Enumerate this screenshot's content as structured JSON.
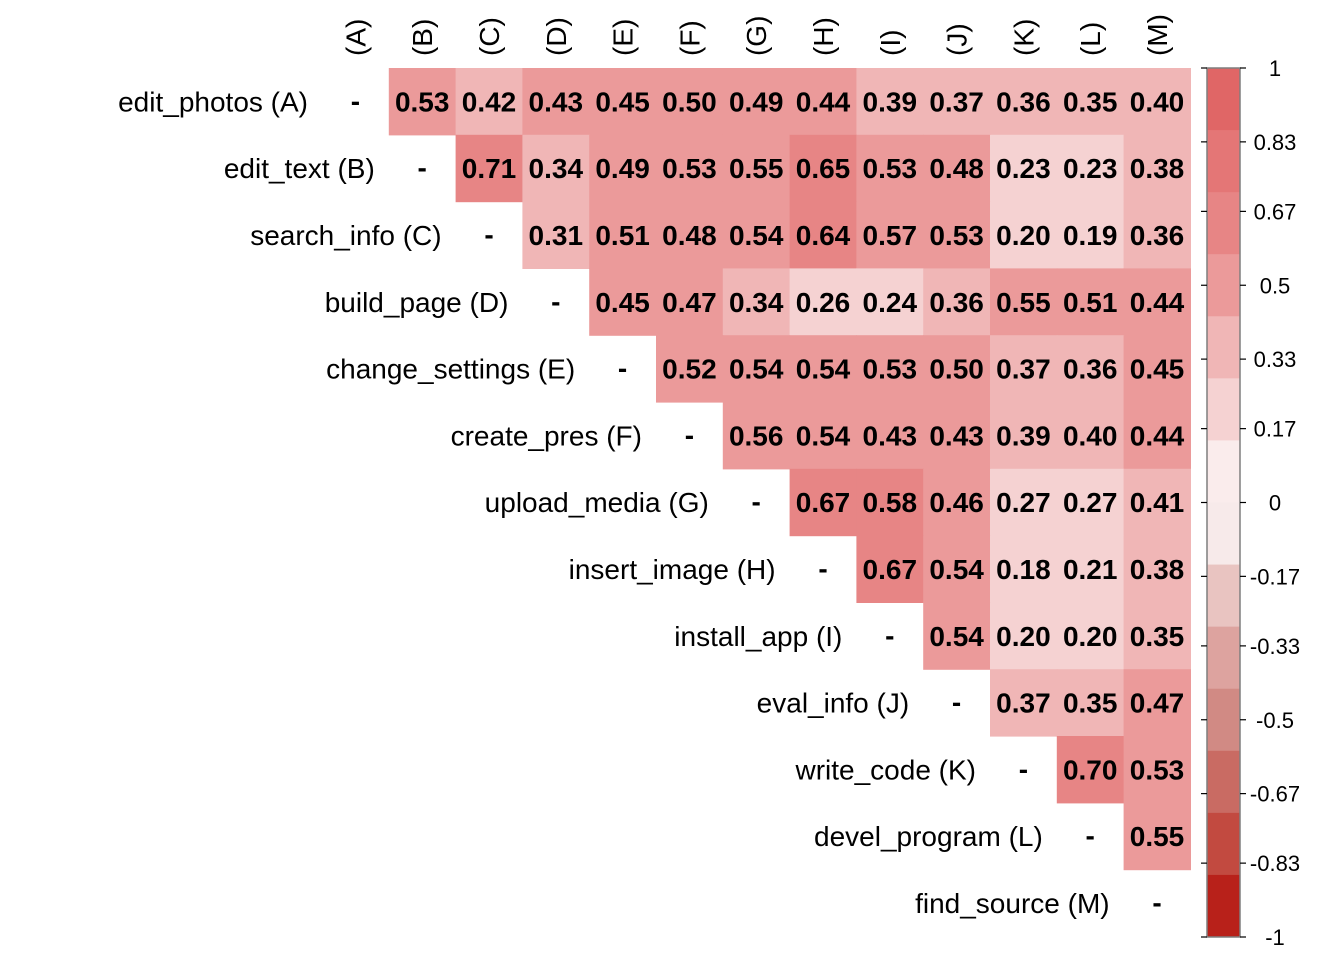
{
  "chart_data": {
    "type": "heatmap",
    "subtype": "correlation-matrix-upper-triangle",
    "row_labels": [
      "edit_photos (A)",
      "edit_text (B)",
      "search_info (C)",
      "build_page (D)",
      "change_settings (E)",
      "create_pres (F)",
      "upload_media (G)",
      "insert_image (H)",
      "install_app (I)",
      "eval_info (J)",
      "write_code (K)",
      "devel_program (L)",
      "find_source (M)"
    ],
    "column_labels": [
      "(A)",
      "(B)",
      "(C)",
      "(D)",
      "(E)",
      "(F)",
      "(G)",
      "(H)",
      "(I)",
      "(J)",
      "(K)",
      "(L)",
      "(M)"
    ],
    "diagonal_label": "-",
    "values": [
      [
        null,
        0.53,
        0.42,
        0.43,
        0.45,
        0.5,
        0.49,
        0.44,
        0.39,
        0.37,
        0.36,
        0.35,
        0.4
      ],
      [
        null,
        null,
        0.71,
        0.34,
        0.49,
        0.53,
        0.55,
        0.65,
        0.53,
        0.48,
        0.23,
        0.23,
        0.38
      ],
      [
        null,
        null,
        null,
        0.31,
        0.51,
        0.48,
        0.54,
        0.64,
        0.57,
        0.53,
        0.2,
        0.19,
        0.36
      ],
      [
        null,
        null,
        null,
        null,
        0.45,
        0.47,
        0.34,
        0.26,
        0.24,
        0.36,
        0.55,
        0.51,
        0.44
      ],
      [
        null,
        null,
        null,
        null,
        null,
        0.52,
        0.54,
        0.54,
        0.53,
        0.5,
        0.37,
        0.36,
        0.45
      ],
      [
        null,
        null,
        null,
        null,
        null,
        null,
        0.56,
        0.54,
        0.43,
        0.43,
        0.39,
        0.4,
        0.44
      ],
      [
        null,
        null,
        null,
        null,
        null,
        null,
        null,
        0.67,
        0.58,
        0.46,
        0.27,
        0.27,
        0.41
      ],
      [
        null,
        null,
        null,
        null,
        null,
        null,
        null,
        null,
        0.67,
        0.54,
        0.18,
        0.21,
        0.38
      ],
      [
        null,
        null,
        null,
        null,
        null,
        null,
        null,
        null,
        null,
        0.54,
        0.2,
        0.2,
        0.35
      ],
      [
        null,
        null,
        null,
        null,
        null,
        null,
        null,
        null,
        null,
        null,
        0.37,
        0.35,
        0.47
      ],
      [
        null,
        null,
        null,
        null,
        null,
        null,
        null,
        null,
        null,
        null,
        null,
        0.7,
        0.53
      ],
      [
        null,
        null,
        null,
        null,
        null,
        null,
        null,
        null,
        null,
        null,
        null,
        null,
        0.55
      ],
      [
        null,
        null,
        null,
        null,
        null,
        null,
        null,
        null,
        null,
        null,
        null,
        null,
        null
      ]
    ],
    "value_labels": [
      [
        null,
        "0.53",
        "0.42",
        "0.43",
        "0.45",
        "0.50",
        "0.49",
        "0.44",
        "0.39",
        "0.37",
        "0.36",
        "0.35",
        "0.40"
      ],
      [
        null,
        null,
        "0.71",
        "0.34",
        "0.49",
        "0.53",
        "0.55",
        "0.65",
        "0.53",
        "0.48",
        "0.23",
        "0.23",
        "0.38"
      ],
      [
        null,
        null,
        null,
        "0.31",
        "0.51",
        "0.48",
        "0.54",
        "0.64",
        "0.57",
        "0.53",
        "0.20",
        "0.19",
        "0.36"
      ],
      [
        null,
        null,
        null,
        null,
        "0.45",
        "0.47",
        "0.34",
        "0.26",
        "0.24",
        "0.36",
        "0.55",
        "0.51",
        "0.44"
      ],
      [
        null,
        null,
        null,
        null,
        null,
        "0.52",
        "0.54",
        "0.54",
        "0.53",
        "0.50",
        "0.37",
        "0.36",
        "0.45"
      ],
      [
        null,
        null,
        null,
        null,
        null,
        null,
        "0.56",
        "0.54",
        "0.43",
        "0.43",
        "0.39",
        "0.40",
        "0.44"
      ],
      [
        null,
        null,
        null,
        null,
        null,
        null,
        null,
        "0.67",
        "0.58",
        "0.46",
        "0.27",
        "0.27",
        "0.41"
      ],
      [
        null,
        null,
        null,
        null,
        null,
        null,
        null,
        null,
        "0.67",
        "0.54",
        "0.18",
        "0.21",
        "0.38"
      ],
      [
        null,
        null,
        null,
        null,
        null,
        null,
        null,
        null,
        null,
        "0.54",
        "0.20",
        "0.20",
        "0.35"
      ],
      [
        null,
        null,
        null,
        null,
        null,
        null,
        null,
        null,
        null,
        null,
        "0.37",
        "0.35",
        "0.47"
      ],
      [
        null,
        null,
        null,
        null,
        null,
        null,
        null,
        null,
        null,
        null,
        null,
        "0.70",
        "0.53"
      ],
      [
        null,
        null,
        null,
        null,
        null,
        null,
        null,
        null,
        null,
        null,
        null,
        null,
        "0.55"
      ],
      [
        null,
        null,
        null,
        null,
        null,
        null,
        null,
        null,
        null,
        null,
        null,
        null,
        null
      ]
    ],
    "color_scale": {
      "range": [
        -1,
        1
      ],
      "tick_labels": [
        "1",
        "0.83",
        "0.67",
        "0.5",
        "0.33",
        "0.17",
        "0",
        "-0.17",
        "-0.33",
        "-0.5",
        "-0.67",
        "-0.83",
        "-1"
      ],
      "tick_values": [
        1,
        0.83,
        0.67,
        0.5,
        0.33,
        0.17,
        0,
        -0.17,
        -0.33,
        -0.5,
        -0.67,
        -0.83,
        -1
      ],
      "bins": [
        {
          "from": 0.857,
          "to": 1.0,
          "color": "#E06666"
        },
        {
          "from": 0.714,
          "to": 0.857,
          "color": "#E47676"
        },
        {
          "from": 0.571,
          "to": 0.714,
          "color": "#E78585"
        },
        {
          "from": 0.429,
          "to": 0.571,
          "color": "#EB9A9A"
        },
        {
          "from": 0.286,
          "to": 0.429,
          "color": "#F0B6B6"
        },
        {
          "from": 0.143,
          "to": 0.286,
          "color": "#F5D2D2"
        },
        {
          "from": 0.0,
          "to": 0.143,
          "color": "#FAECEC"
        },
        {
          "from": -0.143,
          "to": 0.0,
          "color": "#F7EAEA"
        },
        {
          "from": -0.286,
          "to": -0.143,
          "color": "#E9C4C1"
        },
        {
          "from": -0.429,
          "to": -0.286,
          "color": "#DDA39F"
        },
        {
          "from": -0.571,
          "to": -0.429,
          "color": "#D18A84"
        },
        {
          "from": -0.714,
          "to": -0.571,
          "color": "#C96B63"
        },
        {
          "from": -0.857,
          "to": -0.714,
          "color": "#C24A40"
        },
        {
          "from": -1.0,
          "to": -0.857,
          "color": "#B8211A"
        }
      ]
    },
    "legend_position": "right",
    "grid": false
  }
}
